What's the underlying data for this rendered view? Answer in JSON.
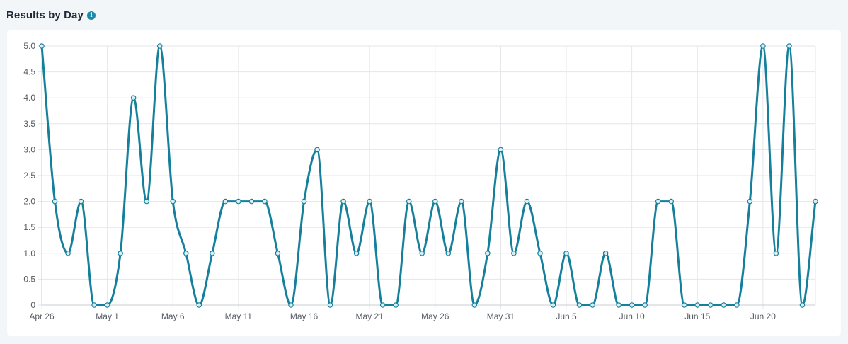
{
  "header": {
    "title": "Results by Day",
    "info_icon": "info-icon"
  },
  "colors": {
    "line": "#14809c",
    "grid": "#e4e6e9",
    "point_fill": "#d9eef3"
  },
  "chart_data": {
    "type": "line",
    "title": "Results by Day",
    "xlabel": "",
    "ylabel": "",
    "ylim": [
      0,
      5
    ],
    "y_ticks": [
      "0",
      "0.5",
      "1.0",
      "1.5",
      "2.0",
      "2.5",
      "3.0",
      "3.5",
      "4.0",
      "4.5",
      "5.0"
    ],
    "x_ticks": [
      "Apr 26",
      "May 1",
      "May 6",
      "May 11",
      "May 16",
      "May 21",
      "May 26",
      "May 31",
      "Jun 5",
      "Jun 10",
      "Jun 15",
      "Jun 20"
    ],
    "x_tick_every": 5,
    "grid": true,
    "smooth": true,
    "series": [
      {
        "values": [
          5,
          2,
          1,
          2,
          0,
          0,
          1,
          4,
          2,
          5,
          2,
          1,
          0,
          1,
          2,
          2,
          2,
          2,
          1,
          0,
          2,
          3,
          0,
          2,
          1,
          2,
          0,
          0,
          2,
          1,
          2,
          1,
          2,
          0,
          1,
          3,
          1,
          2,
          1,
          0,
          1,
          0,
          0,
          1,
          0,
          0,
          0,
          2,
          2,
          0,
          0,
          0,
          0,
          0,
          2,
          5,
          1,
          5,
          0,
          2
        ]
      }
    ]
  }
}
